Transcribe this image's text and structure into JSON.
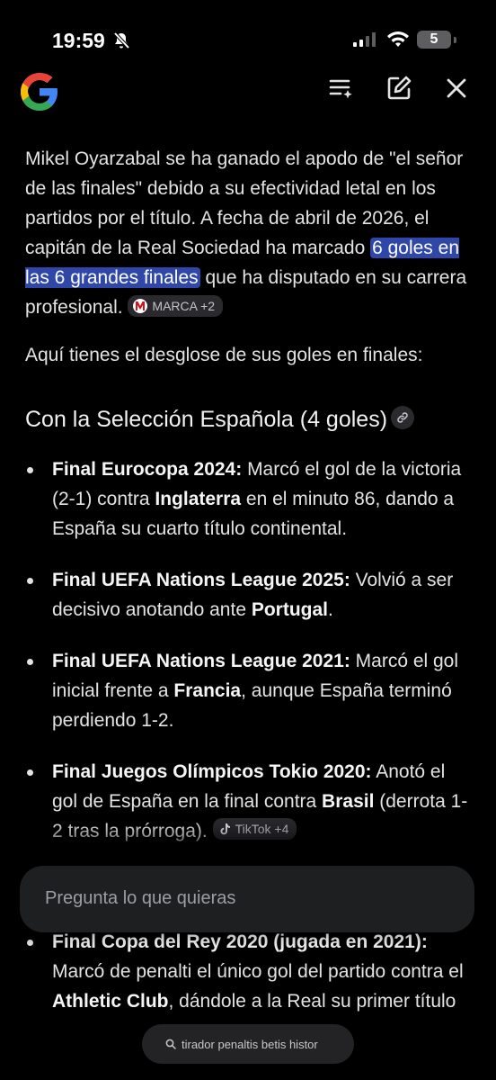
{
  "status_bar": {
    "time": "19:59",
    "battery": "5"
  },
  "intro": {
    "text_before": "Mikel Oyarzabal se ha ganado el apodo de \"el señor de las finales\" debido a su efectividad letal en los partidos por el título. A fecha de abril de 2026, el capitán de la Real Sociedad ha marcado ",
    "highlight": "6 goles en las 6 grandes finales",
    "text_after": " que ha disputado en su carrera profesional. ",
    "source_chip": "MARCA +2"
  },
  "lead": "Aquí tienes el desglose de sus goles en finales:",
  "section_title": "Con la Selección Española (4 goles)",
  "items": [
    {
      "title": "Final Eurocopa 2024:",
      "t1": " Marcó el gol de la victoria (2-1) contra ",
      "b1": "Inglaterra",
      "t2": " en el minuto 86, dando a España su cuarto título continental."
    },
    {
      "title": "Final UEFA Nations League 2025:",
      "t1": " Volvió a ser decisivo anotando ante ",
      "b1": "Portugal",
      "t2": "."
    },
    {
      "title": "Final UEFA Nations League 2021:",
      "t1": " Marcó el gol inicial frente a ",
      "b1": "Francia",
      "t2": ", aunque España terminó perdiendo 1-2."
    },
    {
      "title": "Final Juegos Olímpicos Tokio 2020:",
      "t1": " Anotó el gol de España en la final contra ",
      "b1": "Brasil",
      "t2": " (derrota 1-2 tras la prórroga). ",
      "chip": "TikTok +4"
    }
  ],
  "next_item": {
    "title": "Final Copa del Rey 2020 (jugada en 2021):",
    "t1": " Marcó de penalti el único gol del partido contra el ",
    "b1": "Athletic Club",
    "t2": ", dándole a la Real su primer título"
  },
  "ask_placeholder": "Pregunta lo que quieras",
  "suggestion": "tirador penaltis betis histor",
  "colors": {
    "background": "#000000",
    "highlight": "#2f47a8",
    "chip": "#2a2a2e",
    "input": "#1e1f21"
  }
}
